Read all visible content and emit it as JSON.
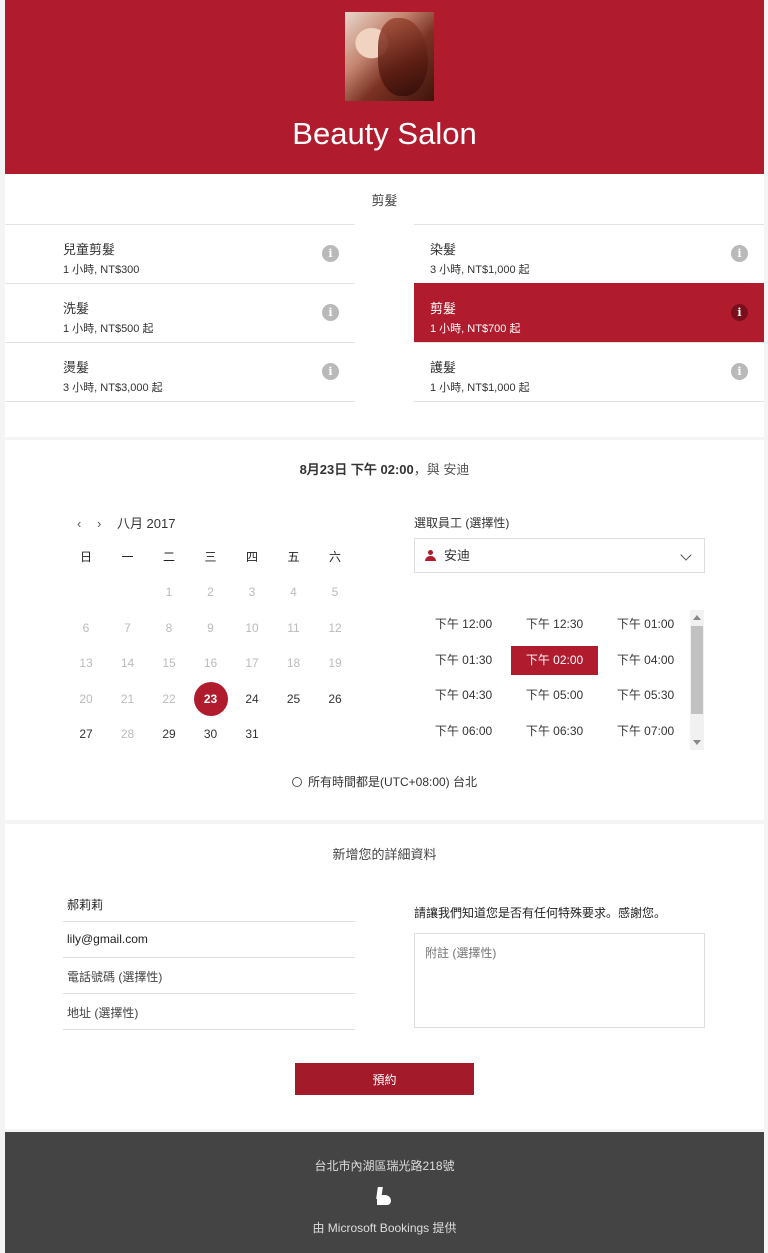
{
  "header": {
    "title": "Beauty Salon",
    "logo": "salon-hair-photo"
  },
  "services": {
    "category": "剪髮",
    "items": [
      {
        "name": "兒童剪髮",
        "detail": "1 小時, NT$300",
        "selected": false
      },
      {
        "name": "染髮",
        "detail": "3 小時, NT$1,000 起",
        "selected": false
      },
      {
        "name": "洗髮",
        "detail": "1 小時, NT$500 起",
        "selected": false
      },
      {
        "name": "剪髮",
        "detail": "1 小時, NT$700 起",
        "selected": true
      },
      {
        "name": "燙髮",
        "detail": "3 小時, NT$3,000 起",
        "selected": false
      },
      {
        "name": "護髮",
        "detail": "1 小時, NT$1,000 起",
        "selected": false
      }
    ],
    "info_icon": "i"
  },
  "schedule": {
    "summary_date": "8月23日",
    "summary_time": "下午 02:00",
    "summary_suffix": "，與 安迪",
    "month_label": "八月 2017",
    "prev_icon": "‹",
    "next_icon": "›",
    "weekdays": [
      "日",
      "一",
      "二",
      "三",
      "四",
      "五",
      "六"
    ],
    "weeks": [
      [
        "",
        "",
        "1",
        "2",
        "3",
        "4",
        "5"
      ],
      [
        "6",
        "7",
        "8",
        "9",
        "10",
        "11",
        "12"
      ],
      [
        "13",
        "14",
        "15",
        "16",
        "17",
        "18",
        "19"
      ],
      [
        "20",
        "21",
        "22",
        "23",
        "24",
        "25",
        "26"
      ],
      [
        "27",
        "28",
        "29",
        "30",
        "31",
        "",
        ""
      ]
    ],
    "selected_day": "23",
    "available_days": [
      "23",
      "24",
      "25",
      "26",
      "27",
      "29",
      "30",
      "31"
    ],
    "staff_label": "選取員工 (選擇性)",
    "staff_value": "安迪",
    "slots": [
      "下午 12:00",
      "下午 12:30",
      "下午 01:00",
      "下午 01:30",
      "下午 02:00",
      "下午 04:00",
      "下午 04:30",
      "下午 05:00",
      "下午 05:30",
      "下午 06:00",
      "下午 06:30",
      "下午 07:00"
    ],
    "selected_slot": "下午 02:00",
    "timezone": "所有時間都是(UTC+08:00) 台北"
  },
  "details": {
    "title": "新增您的詳細資料",
    "name_value": "郝莉莉",
    "email_value": "lily@gmail.com",
    "phone_placeholder": "電話號碼 (選擇性)",
    "address_placeholder": "地址 (選擇性)",
    "request_label": "請讓我們知道您是否有任何特殊要求。感謝您。",
    "notes_placeholder": "附註 (選擇性)",
    "book_label": "預約"
  },
  "footer": {
    "address": "台北市內湖區瑞光路218號",
    "powered_by": "由 Microsoft Bookings 提供"
  },
  "colors": {
    "accent": "#b01c2e",
    "footer": "#444444"
  }
}
